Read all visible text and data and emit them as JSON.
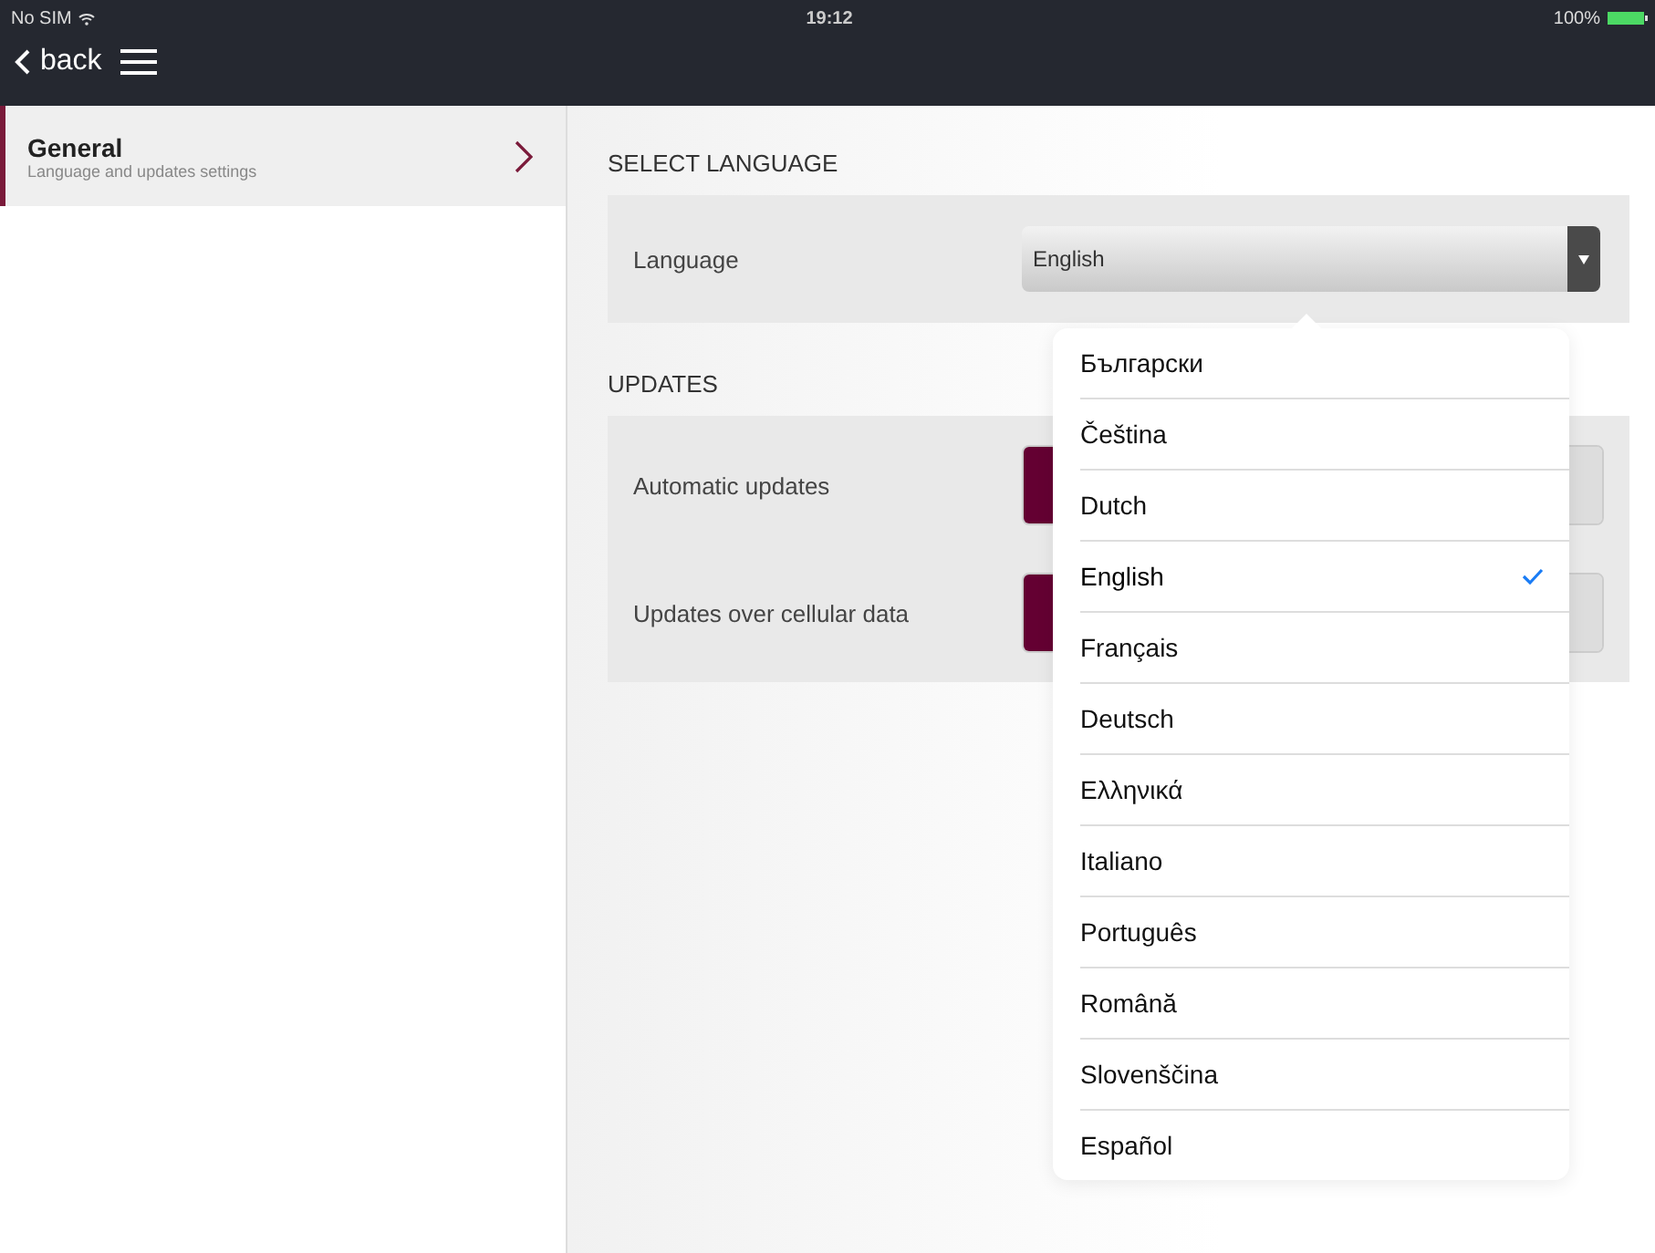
{
  "status_bar": {
    "carrier": "No SIM",
    "time": "19:12",
    "battery": "100%"
  },
  "nav": {
    "back": "back"
  },
  "sidebar": {
    "items": [
      {
        "title": "General",
        "subtitle": "Language and updates settings",
        "selected": true
      }
    ]
  },
  "sections": [
    {
      "heading": "SELECT LANGUAGE",
      "rows": [
        {
          "kind": "select",
          "label": "Language",
          "value": "English"
        }
      ]
    },
    {
      "heading": "UPDATES",
      "rows": [
        {
          "kind": "toggle",
          "label": "Automatic updates",
          "on": true
        },
        {
          "kind": "toggle",
          "label": "Updates over cellular data",
          "on": true
        }
      ]
    }
  ],
  "language_menu": {
    "options": [
      {
        "label": "Български",
        "selected": false
      },
      {
        "label": "Čeština",
        "selected": false
      },
      {
        "label": "Dutch",
        "selected": false
      },
      {
        "label": "English",
        "selected": true
      },
      {
        "label": "Français",
        "selected": false
      },
      {
        "label": "Deutsch",
        "selected": false
      },
      {
        "label": "Ελληνικά",
        "selected": false
      },
      {
        "label": "Italiano",
        "selected": false
      },
      {
        "label": "Português",
        "selected": false
      },
      {
        "label": "Română",
        "selected": false
      },
      {
        "label": "Slovenščina",
        "selected": false
      },
      {
        "label": "Español",
        "selected": false
      }
    ]
  }
}
